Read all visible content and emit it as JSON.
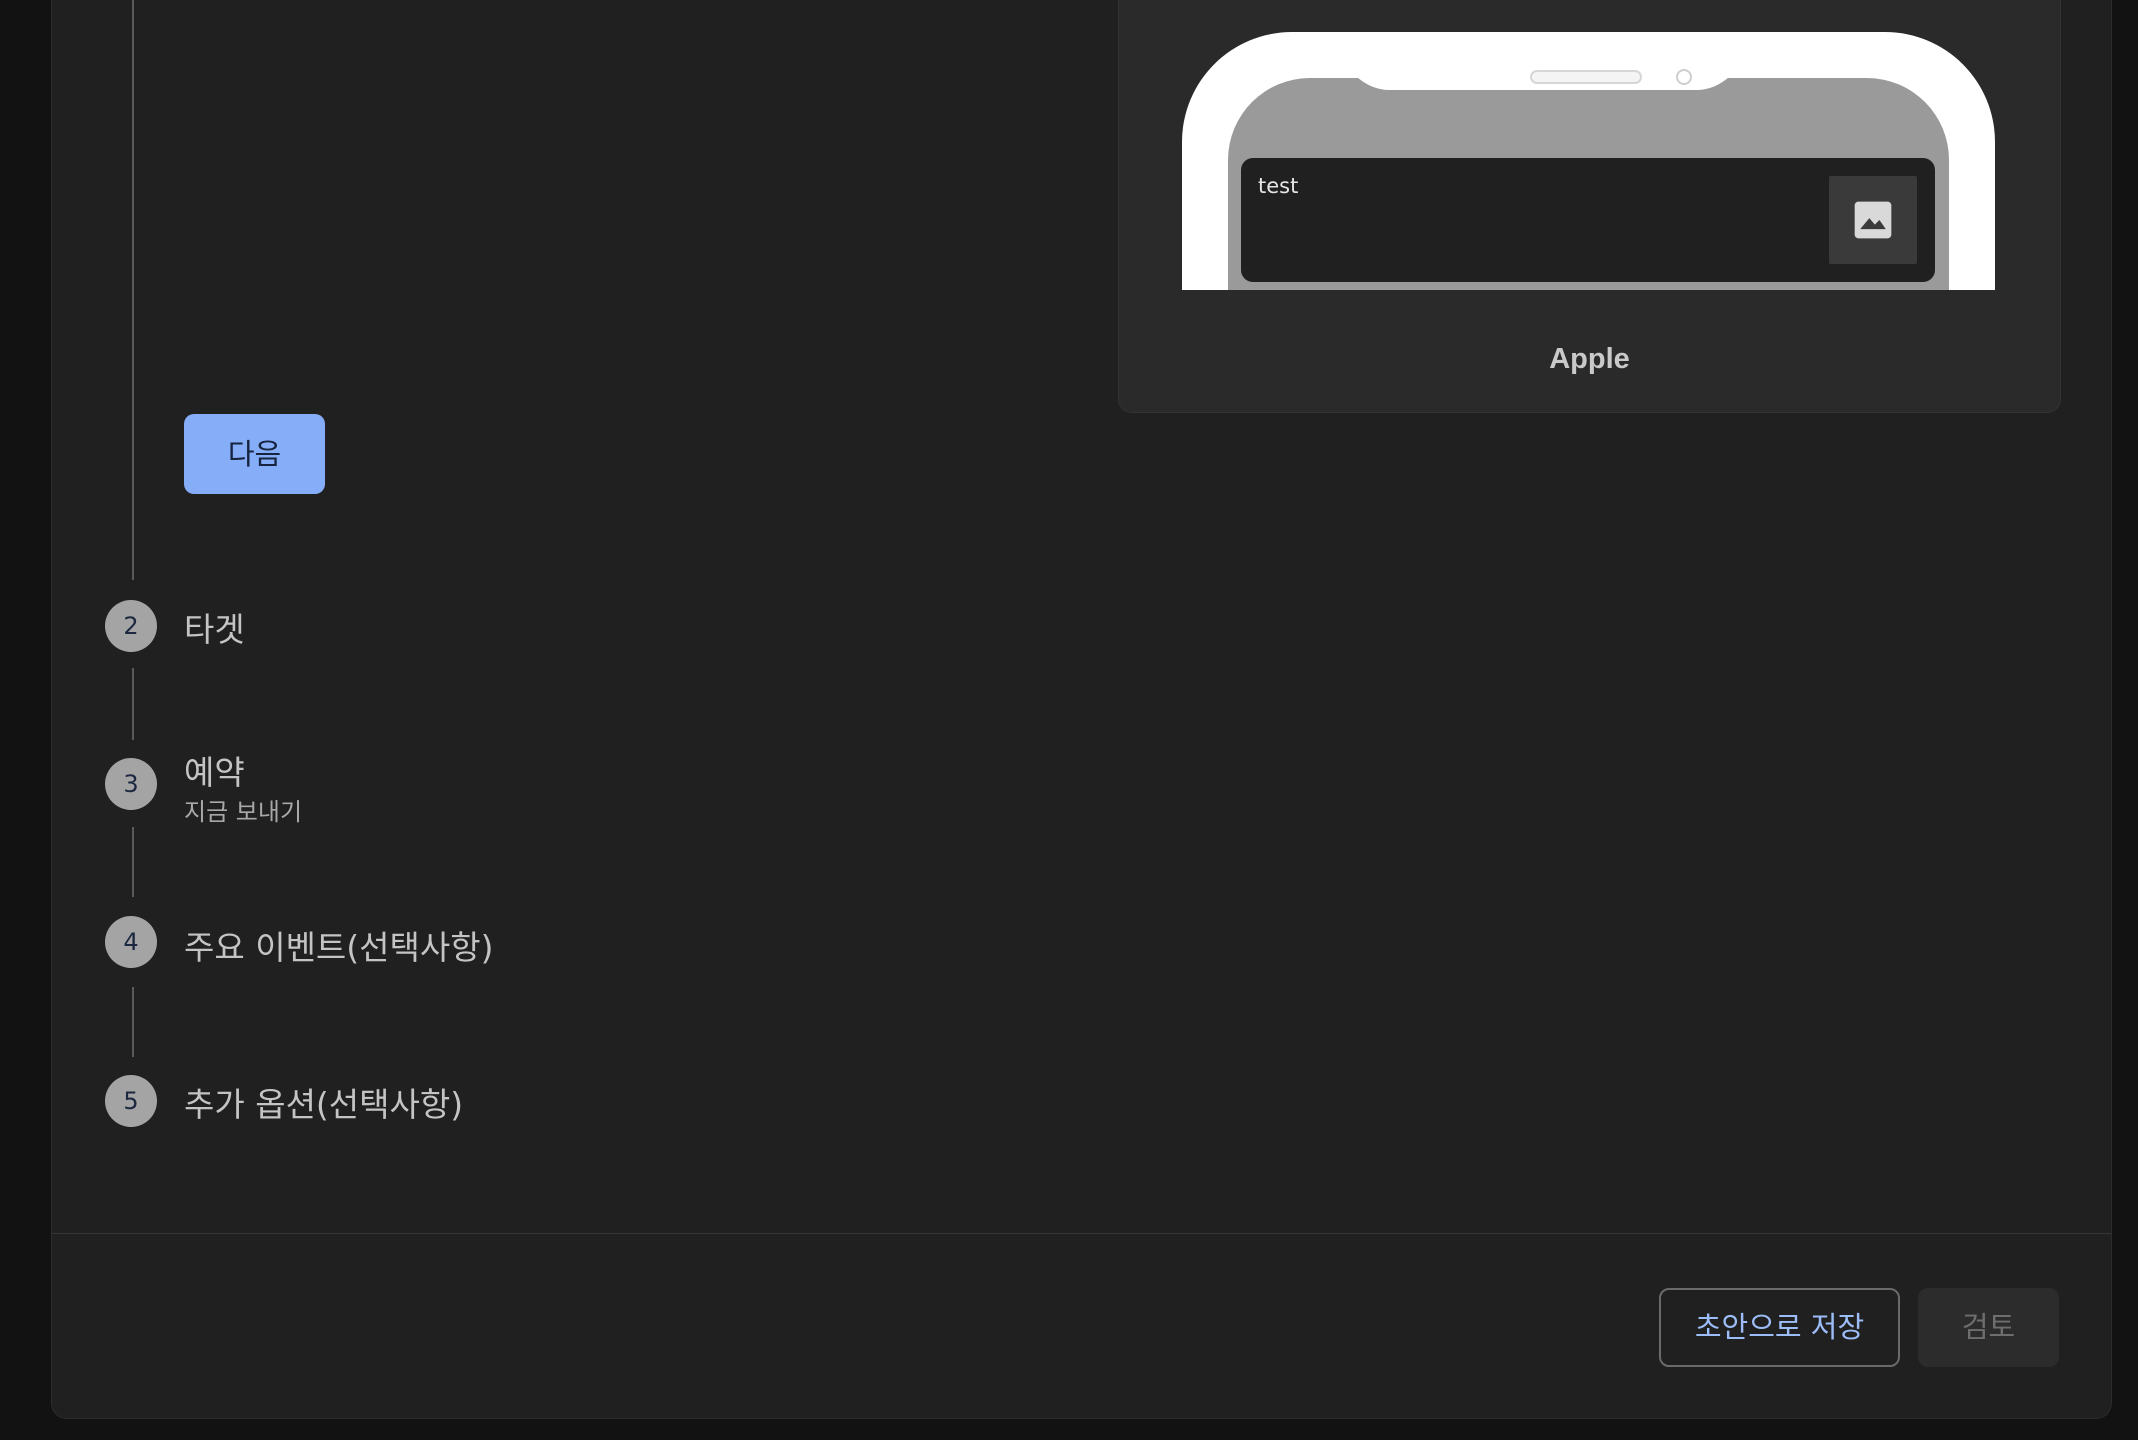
{
  "stepper": {
    "next_label": "다음",
    "steps": [
      {
        "number": "2",
        "title": "타겟"
      },
      {
        "number": "3",
        "title": "예약",
        "subtitle": "지금 보내기"
      },
      {
        "number": "4",
        "title": "주요 이벤트(선택사항)"
      },
      {
        "number": "5",
        "title": "추가 옵션(선택사항)"
      }
    ]
  },
  "preview": {
    "notification_text": "test",
    "image_icon": "image-icon",
    "platform_label": "Apple"
  },
  "footer": {
    "save_draft_label": "초안으로 저장",
    "review_label": "검토"
  },
  "colors": {
    "primary": "#86aef8",
    "background": "#202020",
    "step_circle": "#a4a4a4"
  }
}
